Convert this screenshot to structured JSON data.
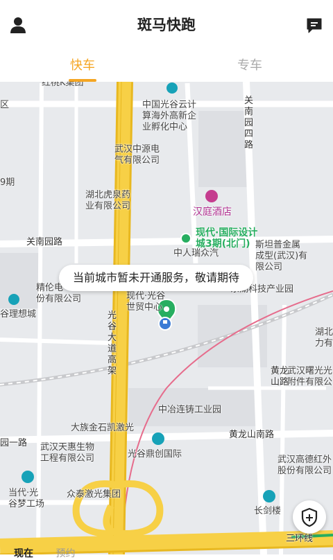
{
  "header": {
    "title": "斑马快跑",
    "user_icon": "user-icon",
    "message_icon": "message-icon"
  },
  "tabs": [
    {
      "label": "快车",
      "active": true
    },
    {
      "label": "专车",
      "active": false
    }
  ],
  "map": {
    "labels": {
      "group_top": "红桃K集团",
      "qu": "区",
      "phase9": "9期",
      "optics_cloud": "中国光谷云计\n算海外高新企\n业孵化中心",
      "zhongyuan": "武汉中源电\n气有限公司",
      "huquan": "湖北虎泉药\n业有限公司",
      "hanting": "汉庭酒店",
      "modern_city": "现代·国际设计\n城3期(北门)",
      "guannan_road": "关南园路",
      "guannan_4": "关南园四路",
      "zhongren": "中人瑞众汽",
      "newsintan": "斯坦普金属\n成型(武汉)有\n限公司",
      "jinglun": "精伦电\n份有限公司",
      "guguangxiang": "谷理想城",
      "dongnong": "东湖科技产业园",
      "xiandai_guang": "现代·光谷\n世贸中心",
      "guanggu_road": "光谷大道高架",
      "hubei_li": "湖北\n力有",
      "huanglong_road": "黄龙\n山路",
      "shuguang": "武汉曙光光\n附件有限公",
      "zhongye": "中冶连铸工业园",
      "dazu": "大族金石凯激光",
      "huanglong_south": "黄龙山南路",
      "guanyi_road": "园一路",
      "tianhui": "武汉天惠生物\n工程有限公司",
      "dingchuang": "光谷鼎创国际",
      "gaode": "武汉高德红外\n股份有限公司",
      "dangdai": "当代·光\n谷梦工场",
      "zhongtai": "众泰激光集团",
      "changjian": "长剑楼",
      "ring3": "三环线"
    }
  },
  "toast": {
    "text": "当前城市暂未开通服务，敬请期待"
  },
  "bottom": {
    "left": "现在",
    "right": "预约"
  },
  "colors": {
    "accent": "#F5A623",
    "road_major": "#F4C430",
    "road_minor": "#FFFFFF",
    "map_bg": "#E8EAED",
    "pin": "#27AE60",
    "location": "#3A7BD5"
  }
}
